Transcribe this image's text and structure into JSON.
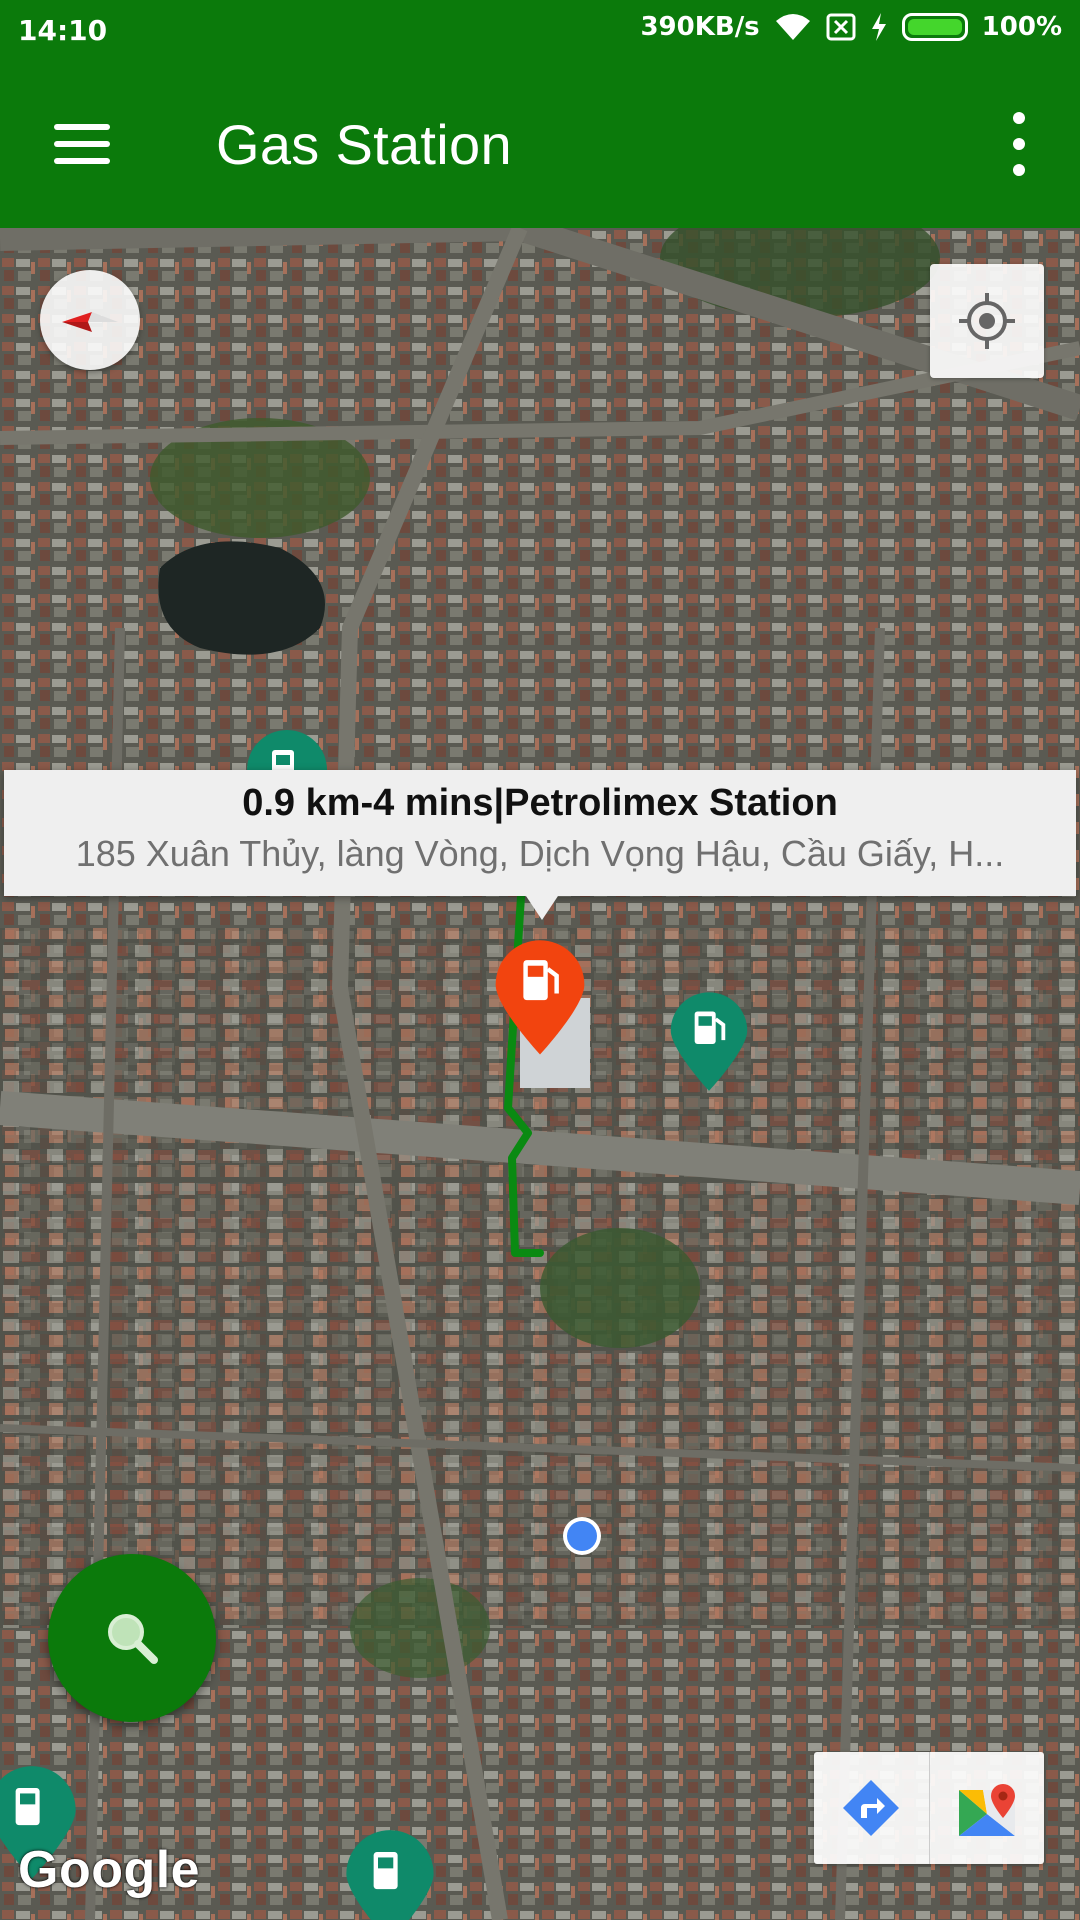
{
  "status_bar": {
    "time": "14:10",
    "net_speed": "390KB/s",
    "battery": "100%"
  },
  "app_bar": {
    "title": "Gas Station",
    "menu_icon": "hamburger-menu-icon",
    "overflow_icon": "more-vert-icon"
  },
  "map": {
    "info_window": {
      "title": "0.9 km-4 mins|Petrolimex Station",
      "address": "185 Xuân Thủy, làng Vòng, Dịch Vọng Hậu, Cầu Giấy, H..."
    },
    "attribution": "Google",
    "route_color": "#0a8a12",
    "selected_marker_color": "#f2440f",
    "station_marker_color": "#0f8a6a",
    "user_location_color": "#4285f4"
  },
  "colors": {
    "primary": "#0b7a0b"
  }
}
